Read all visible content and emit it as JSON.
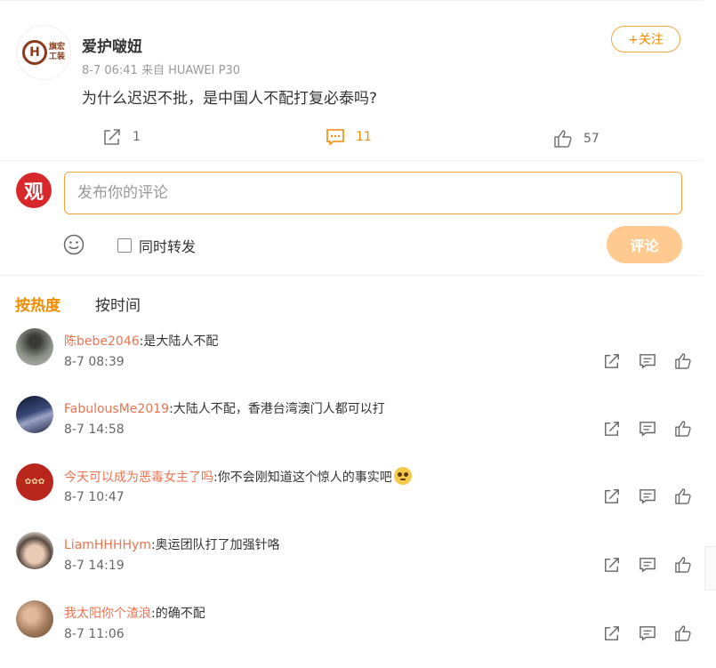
{
  "post": {
    "author": "爱护啵妞",
    "meta": "8-7 06:41  来自 HUAWEI P30",
    "logo_text_top": "旗宏",
    "logo_text_bottom": "工装",
    "follow_label": "+关注",
    "text": "为什么迟迟不批，是中国人不配打复必泰吗?",
    "reposts": "1",
    "comments": "11",
    "likes": "57"
  },
  "composer": {
    "avatar_char": "观",
    "placeholder": "发布你的评论",
    "repost_label": "同时转发",
    "submit_label": "评论"
  },
  "sort": {
    "hot": "按热度",
    "time": "按时间"
  },
  "comments": [
    {
      "user": "陈bebe2046",
      "text": ":是大陆人不配",
      "time": "8-7 08:39",
      "avatar_color": "#6b6f63"
    },
    {
      "user": "FabulousMe2019",
      "text": ":大陆人不配，香港台湾澳门人都可以打",
      "time": "8-7 14:58",
      "avatar_color": "#2a3557"
    },
    {
      "user": "今天可以成为恶毒女主了吗",
      "text": ":你不会刚知道这个惊人的事实吧",
      "time": "8-7 10:47",
      "avatar_color": "#b8261c"
    },
    {
      "user": "LiamHHHHym",
      "text": ":奥运团队打了加强针咯",
      "time": "8-7 14:19",
      "avatar_color": "#c8b7a8"
    },
    {
      "user": "我太阳你个渣浪",
      "text": ":的确不配",
      "time": "8-7 11:06",
      "avatar_color": "#a0785a"
    }
  ],
  "colors": {
    "accent": "#f28b00",
    "username": "#eb7350",
    "submit_disabled": "#ffca8f"
  },
  "icons": [
    "repost-icon",
    "comment-icon",
    "like-icon",
    "emoji-icon",
    "avatar"
  ]
}
